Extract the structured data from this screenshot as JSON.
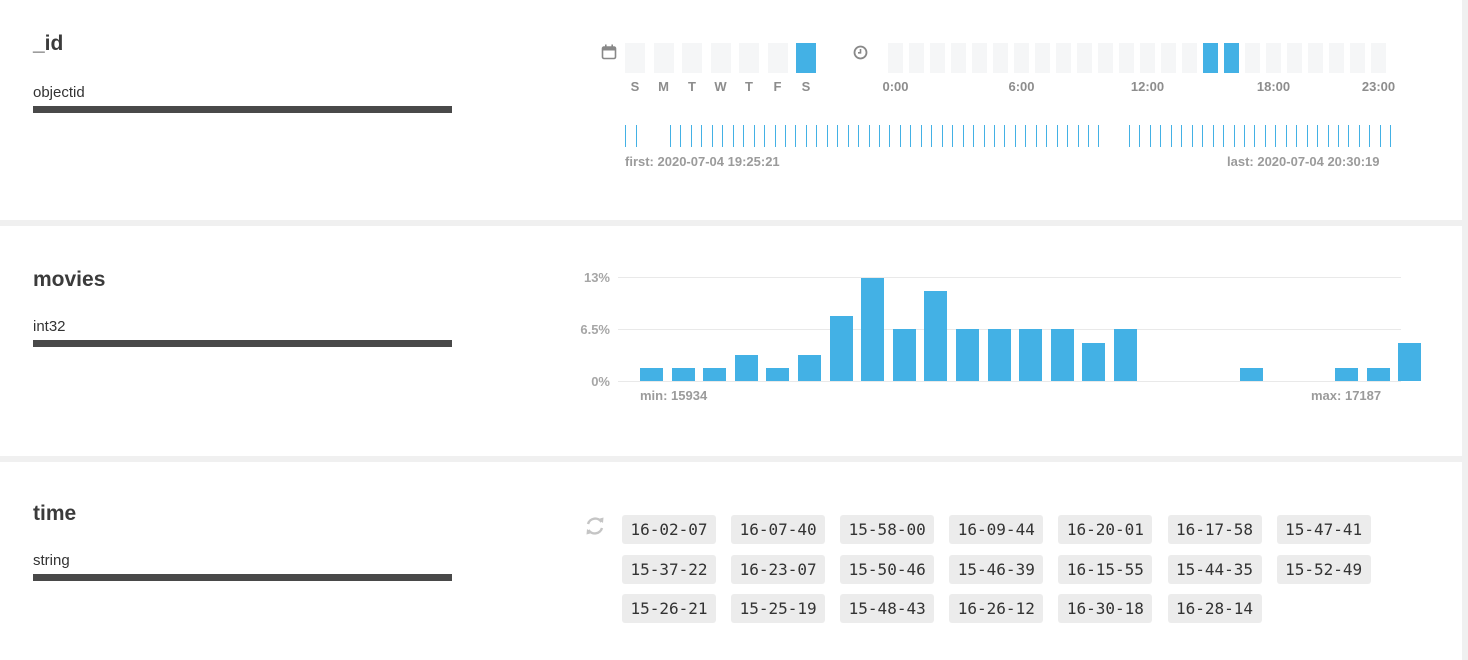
{
  "fields": [
    {
      "name": "_id",
      "type": "objectid",
      "days": {
        "labels": [
          "S",
          "M",
          "T",
          "W",
          "T",
          "F",
          "S"
        ],
        "selected": [
          6
        ]
      },
      "hours": {
        "labels": [
          "0:00",
          "6:00",
          "12:00",
          "18:00",
          "23:00"
        ],
        "selected": [
          15,
          16
        ]
      },
      "timeline": {
        "first": "first: 2020-07-04 19:25:21",
        "last": "last: 2020-07-04 20:30:19"
      },
      "icons": {
        "calendar": "calendar-icon",
        "clock": "clock-icon"
      }
    },
    {
      "name": "movies",
      "type": "int32",
      "min_label": "min: 15934",
      "max_label": "max: 17187"
    },
    {
      "name": "time",
      "type": "string",
      "refresh_icon": "refresh-icon",
      "values": [
        "16-02-07",
        "16-07-40",
        "15-58-00",
        "16-09-44",
        "16-20-01",
        "16-17-58",
        "15-47-41",
        "15-37-22",
        "16-23-07",
        "15-50-46",
        "15-46-39",
        "16-15-55",
        "15-44-35",
        "15-52-49",
        "15-26-21",
        "15-25-19",
        "15-48-43",
        "16-26-12",
        "16-30-18",
        "16-28-14"
      ]
    }
  ],
  "colors": {
    "accent": "#43b1e5",
    "cell": "#f5f6f7",
    "bar": "#494949"
  },
  "chart_data": {
    "type": "bar",
    "ylim": [
      0,
      13
    ],
    "yticks": [
      "0%",
      "6.5%",
      "13%"
    ],
    "values": [
      1.6,
      1.6,
      1.6,
      3.2,
      1.6,
      3.2,
      8.1,
      12.9,
      6.5,
      11.3,
      6.5,
      6.5,
      6.5,
      6.5,
      4.8,
      6.5,
      0,
      0,
      0,
      1.6,
      0,
      0,
      1.6,
      1.6,
      4.8
    ],
    "xlabel": "",
    "ylabel": ""
  }
}
